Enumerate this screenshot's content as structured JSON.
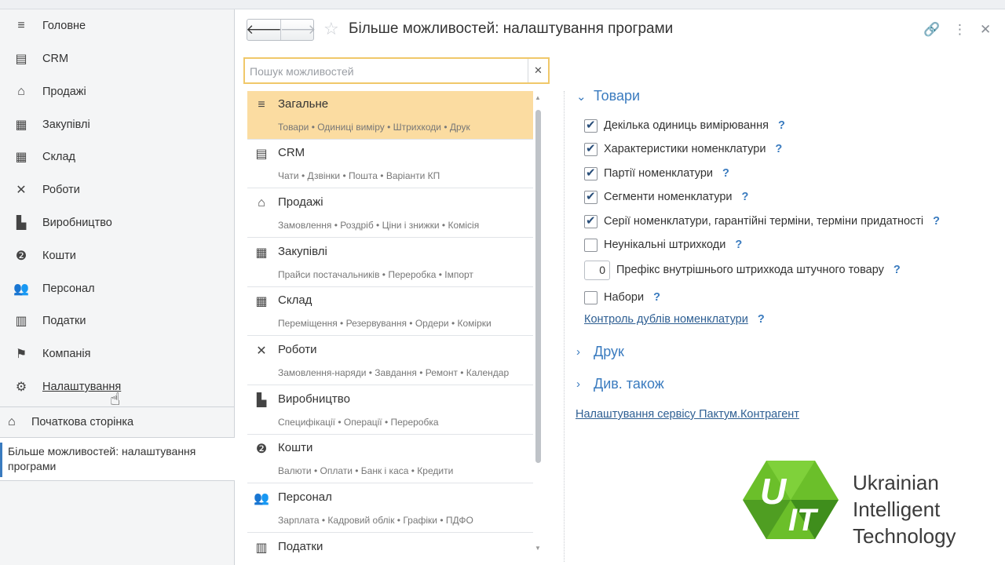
{
  "sidebar": {
    "items": [
      {
        "label": "Головне",
        "icon": "menu-icon"
      },
      {
        "label": "CRM",
        "icon": "contact-card-icon"
      },
      {
        "label": "Продажі",
        "icon": "basket-icon"
      },
      {
        "label": "Закупівлі",
        "icon": "cart-icon"
      },
      {
        "label": "Склад",
        "icon": "warehouse-icon"
      },
      {
        "label": "Роботи",
        "icon": "tools-icon"
      },
      {
        "label": "Виробництво",
        "icon": "factory-icon"
      },
      {
        "label": "Кошти",
        "icon": "money-icon"
      },
      {
        "label": "Персонал",
        "icon": "people-icon"
      },
      {
        "label": "Податки",
        "icon": "calculator-icon"
      },
      {
        "label": "Компанія",
        "icon": "flag-icon"
      },
      {
        "label": "Налаштування",
        "icon": "gear-icon"
      }
    ],
    "home_label": "Початкова сторінка",
    "open_tab_label": "Більше можливостей: налаштування програми"
  },
  "header": {
    "title": "Більше можливостей: налаштування програми"
  },
  "search": {
    "placeholder": "Пошук можливостей",
    "value": ""
  },
  "sections": [
    {
      "name": "Загальне",
      "sub": "Товари • Одиниці виміру • Штрихкоди • Друк",
      "active": true
    },
    {
      "name": "CRM",
      "sub": "Чати • Дзвінки • Пошта • Варіанти КП"
    },
    {
      "name": "Продажі",
      "sub": "Замовлення • Роздріб • Ціни і знижки • Комісія"
    },
    {
      "name": "Закупівлі",
      "sub": "Прайси постачальників • Переробка • Імпорт"
    },
    {
      "name": "Склад",
      "sub": "Переміщення • Резервування • Ордери • Комірки"
    },
    {
      "name": "Роботи",
      "sub": "Замовлення-наряди • Завдання • Ремонт • Календар"
    },
    {
      "name": "Виробництво",
      "sub": "Специфікації • Операції • Переробка"
    },
    {
      "name": "Кошти",
      "sub": "Валюти • Оплати • Банк і каса • Кредити"
    },
    {
      "name": "Персонал",
      "sub": "Зарплата • Кадровий облік • Графіки • ПДФО"
    },
    {
      "name": "Податки",
      "sub": ""
    }
  ],
  "settings": {
    "group_goods": "Товари",
    "options": [
      {
        "label": "Декілька одиниць вимірювання",
        "checked": true
      },
      {
        "label": "Характеристики номенклатури",
        "checked": true
      },
      {
        "label": "Партії номенклатури",
        "checked": true
      },
      {
        "label": "Сегменти номенклатури",
        "checked": true
      },
      {
        "label": "Серії номенклатури, гарантійні терміни, терміни придатності",
        "checked": true
      },
      {
        "label": "Неунікальні штрихкоди",
        "checked": false
      }
    ],
    "prefix": {
      "value": "0",
      "label": "Префікс внутрішнього штрихкода штучного товару"
    },
    "sets": {
      "label": "Набори",
      "checked": false
    },
    "dup_control_link": "Контроль дублів номенклатури",
    "help_mark": "?",
    "group_print": "Друк",
    "group_see_also": "Див. також",
    "service_link": "Налаштування сервісу Пактум.Контрагент"
  },
  "logo": {
    "line1": "Ukrainian",
    "line2": "Intelligent",
    "line3": "Technology",
    "colors": {
      "green": "#6bbf2a",
      "dark_green": "#3f8e1c"
    }
  },
  "colors": {
    "accent": "#3a7bbf",
    "active_section": "#fbdca1",
    "search_border": "#f0c86a"
  }
}
